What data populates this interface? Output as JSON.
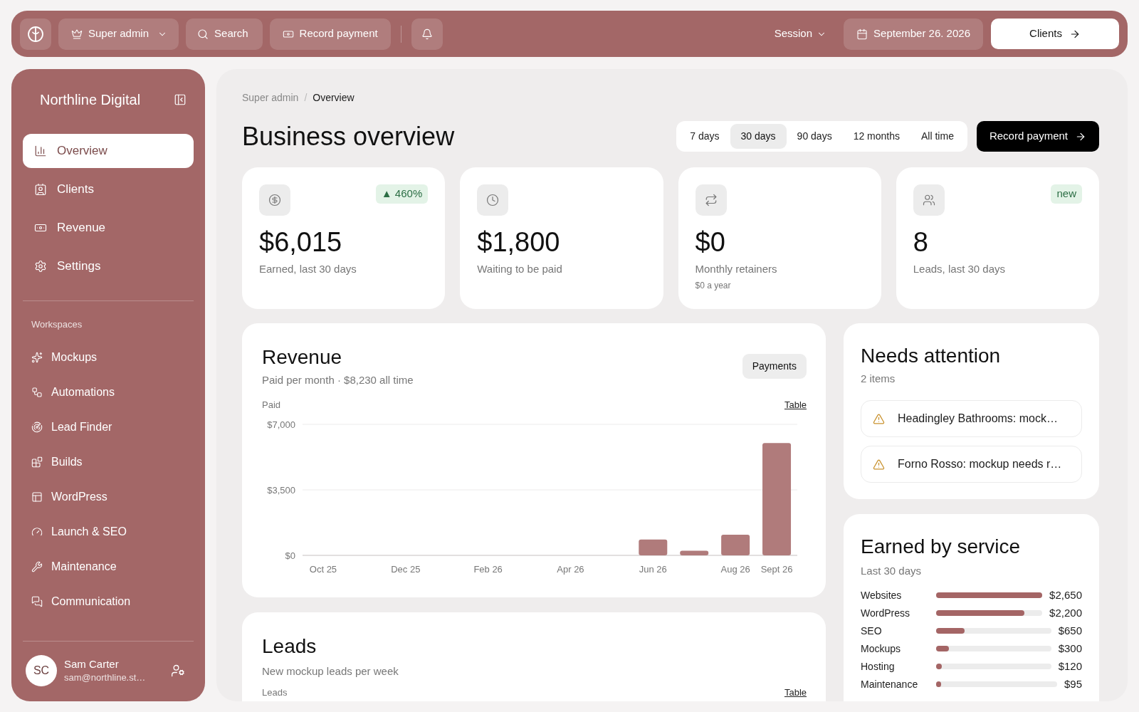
{
  "top_bar": {
    "role_menu": "Super admin",
    "search": "Search",
    "record_payment": "Record payment",
    "session_menu": "Session",
    "date": "September 26. 2026",
    "clients_button": "Clients"
  },
  "sidebar": {
    "title": "Northline Digital",
    "main_items": [
      {
        "label": "Overview",
        "selected": true
      },
      {
        "label": "Clients",
        "selected": false
      },
      {
        "label": "Revenue",
        "selected": false
      },
      {
        "label": "Settings",
        "selected": false
      }
    ],
    "section_label": "Workspaces",
    "workspace_items": [
      {
        "label": "Mockups",
        "selected": false
      },
      {
        "label": "Automations",
        "selected": false
      },
      {
        "label": "Lead Finder",
        "selected": false
      },
      {
        "label": "Builds",
        "selected": false
      },
      {
        "label": "WordPress",
        "selected": false
      },
      {
        "label": "Launch & SEO",
        "selected": false
      },
      {
        "label": "Maintenance",
        "selected": false
      },
      {
        "label": "Communication",
        "selected": false
      }
    ],
    "user": {
      "initials": "SC",
      "name": "Sam Carter",
      "email": "sam@northline.st…"
    }
  },
  "breadcrumb": {
    "items": [
      "Super admin",
      "Overview"
    ],
    "separator": "/"
  },
  "page_title": "Business overview",
  "ranges": [
    {
      "label": "7 days",
      "selected": false
    },
    {
      "label": "30 days",
      "selected": true
    },
    {
      "label": "90 days",
      "selected": false
    },
    {
      "label": "12 months",
      "selected": false
    },
    {
      "label": "All time",
      "selected": false
    }
  ],
  "record_payment_button": "Record payment",
  "stats": [
    {
      "value": "$6,015",
      "label": "Earned, last 30 days",
      "badge": "▲ 460%"
    },
    {
      "value": "$1,800",
      "label": "Waiting to be paid"
    },
    {
      "value": "$0",
      "label": "Monthly retainers",
      "note": "$0 a year"
    },
    {
      "value": "8",
      "label": "Leads, last 30 days",
      "badge": "new"
    }
  ],
  "revenue": {
    "title": "Revenue",
    "subtitle": "Paid per month · $8,230 all time",
    "payments_button": "Payments",
    "table_link": "Table",
    "chart_data": {
      "type": "bar",
      "ylabel": "Paid",
      "categories": [
        "Oct 25",
        null,
        "Dec 25",
        null,
        "Feb 26",
        null,
        "Apr 26",
        null,
        "Jun 26",
        null,
        "Aug 26",
        "Sept 26"
      ],
      "values": [
        0,
        0,
        0,
        0,
        0,
        0,
        0,
        0,
        850,
        250,
        1100,
        6000
      ],
      "ylim": [
        0,
        7000
      ],
      "yticks": [
        {
          "value": 0,
          "label": "$0"
        },
        {
          "value": 3500,
          "label": "$3,500"
        },
        {
          "value": 7000,
          "label": "$7,000"
        }
      ]
    }
  },
  "leads": {
    "title": "Leads",
    "subtitle": "New mockup leads per week",
    "axis_label": "Leads",
    "table_link": "Table"
  },
  "needs_attention": {
    "title": "Needs attention",
    "count": "2 items",
    "items": [
      "Headingley Bathrooms: mock…",
      "Forno Rosso: mockup needs r…"
    ]
  },
  "earned_by_service": {
    "title": "Earned by service",
    "subtitle": "Last 30 days",
    "rows": [
      {
        "service": "Websites",
        "level": 1,
        "amount": "$2,650"
      },
      {
        "service": "WordPress",
        "level": 0.83,
        "amount": "$2,200"
      },
      {
        "service": "SEO",
        "level": 0.25,
        "amount": "$650"
      },
      {
        "service": "Mockups",
        "level": 0.11,
        "amount": "$300"
      },
      {
        "service": "Hosting",
        "level": 0.05,
        "amount": "$120"
      },
      {
        "service": "Maintenance",
        "level": 0.04,
        "amount": "$95"
      }
    ]
  }
}
